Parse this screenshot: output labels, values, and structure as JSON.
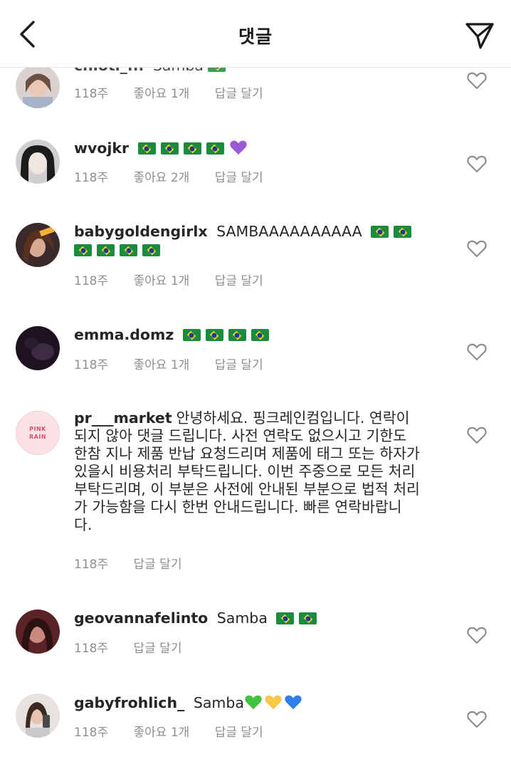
{
  "header": {
    "back_icon": "back-chevron-icon",
    "title": "댓글",
    "send_icon": "send-icon"
  },
  "comments": [
    {
      "username": "chlotl_...",
      "text": "Samba",
      "partial": true,
      "time": "118주",
      "likes": "좋아요 1개",
      "reply": "답글 달기"
    },
    {
      "username": "wvojkr",
      "emojis": [
        "brazil-flag",
        "brazil-flag",
        "brazil-flag",
        "brazil-flag",
        "purple-heart"
      ],
      "time": "118주",
      "likes": "좋아요 2개",
      "reply": "답글 달기"
    },
    {
      "username": "babygoldengirlx",
      "text": "SAMBAAAAAAAAAA",
      "emojis": [
        "brazil-flag",
        "brazil-flag",
        "brazil-flag",
        "brazil-flag",
        "brazil-flag",
        "brazil-flag"
      ],
      "time": "118주",
      "likes": "좋아요 1개",
      "reply": "답글 달기"
    },
    {
      "username": "emma.domz",
      "emojis": [
        "brazil-flag",
        "brazil-flag",
        "brazil-flag",
        "brazil-flag"
      ],
      "time": "118주",
      "likes": "좋아요 1개",
      "reply": "답글 달기"
    },
    {
      "username": "pr___market",
      "avatar_text": [
        "PINK",
        "RAIN"
      ],
      "text_lines": [
        "안녕하세요. 핑크레인컴입니다. 연락이",
        "되지 않아 댓글 드립니다. 사전 연락도 없으시고 기한도",
        "한참 지나 제품 반납 요청드리며 제품에 태그 또는 하자가",
        "있을시 비용처리 부탁드립니다. 이번 주중으로 모든 처리",
        "부탁드리며, 이 부분은 사전에 안내된 부분으로 법적 처리",
        "가 가능함을 다시 한번 안내드립니다.  빠른 연락바랍니",
        "다."
      ],
      "time": "118주",
      "reply": "답글 달기"
    },
    {
      "username": "geovannafelinto",
      "text": "Samba",
      "emojis": [
        "brazil-flag",
        "brazil-flag"
      ],
      "time": "118주",
      "reply": "답글 달기"
    },
    {
      "username": "gabyfrohlich_",
      "text": "Samba",
      "emojis": [
        "green-heart",
        "yellow-heart",
        "blue-heart"
      ],
      "time": "118주",
      "likes": "좋아요 1개",
      "reply": "답글 달기"
    }
  ],
  "colors": {
    "text": "#262626",
    "meta": "#8e8e8e",
    "brazil_green": "#1a8c3e",
    "brazil_yellow": "#f4d22c",
    "brazil_blue": "#203a8c",
    "purple_heart": "#9b59d6",
    "green_heart": "#3fc43f",
    "yellow_heart": "#f7c948",
    "blue_heart": "#2f80ed"
  }
}
